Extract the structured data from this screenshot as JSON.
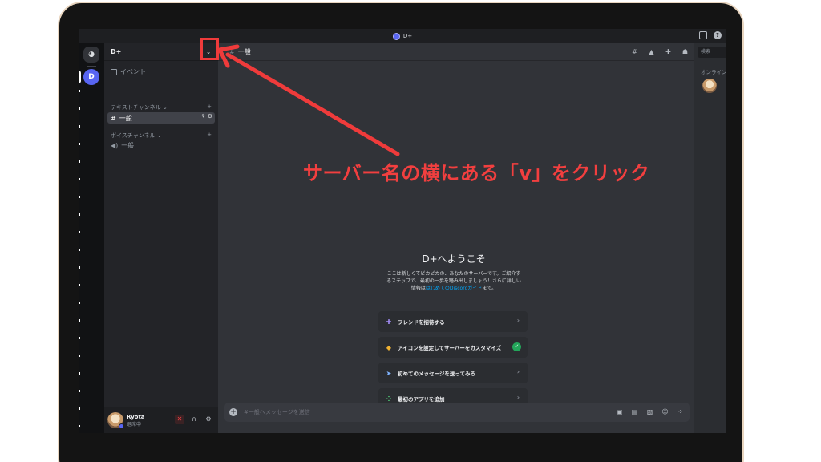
{
  "titlebar": {
    "server_name": "D+"
  },
  "rail": {
    "server_initial": "D"
  },
  "sidebar": {
    "server_name": "D+",
    "chevron": "⌄",
    "events_label": "イベント",
    "text_category": "テキストチャンネル",
    "text_channel": "一般",
    "voice_category": "ボイスチャンネル",
    "voice_channel": "一般",
    "category_caret": "⌄",
    "plus": "+"
  },
  "user": {
    "name": "Ryota",
    "status": "退席中"
  },
  "channel_header": {
    "channel_name": "一般"
  },
  "welcome": {
    "title": "D+へようこそ",
    "text_1": "ここは新しくてピカピカの、あなたのサーバーです。ご紹介す",
    "text_2": "るステップで、最初の一歩を踏み出しましょう！さらに詳しい",
    "text_3_prefix": "情報は",
    "text_3_link": "はじめてのDiscordガイド",
    "text_3_suffix": "まで。"
  },
  "cards": [
    {
      "label": "フレンドを招待する",
      "icon": "person-add-icon"
    },
    {
      "label": "アイコンを設定してサーバーをカスタマイズ",
      "icon": "palette-icon",
      "done": true
    },
    {
      "label": "初めてのメッセージを送ってみる",
      "icon": "send-icon"
    },
    {
      "label": "最初のアプリを追加",
      "icon": "apps-icon"
    }
  ],
  "composer": {
    "placeholder": "#一般へメッセージを送信"
  },
  "members": {
    "search_placeholder": "検索",
    "category": "オンライン"
  },
  "annotation": {
    "text": "サーバー名の横にある「v」をクリック",
    "color": "#ef3b3b"
  },
  "colors": {
    "accent": "#5865f2",
    "success": "#23a55a",
    "danger": "#f23f43",
    "link": "#00a8fc"
  }
}
